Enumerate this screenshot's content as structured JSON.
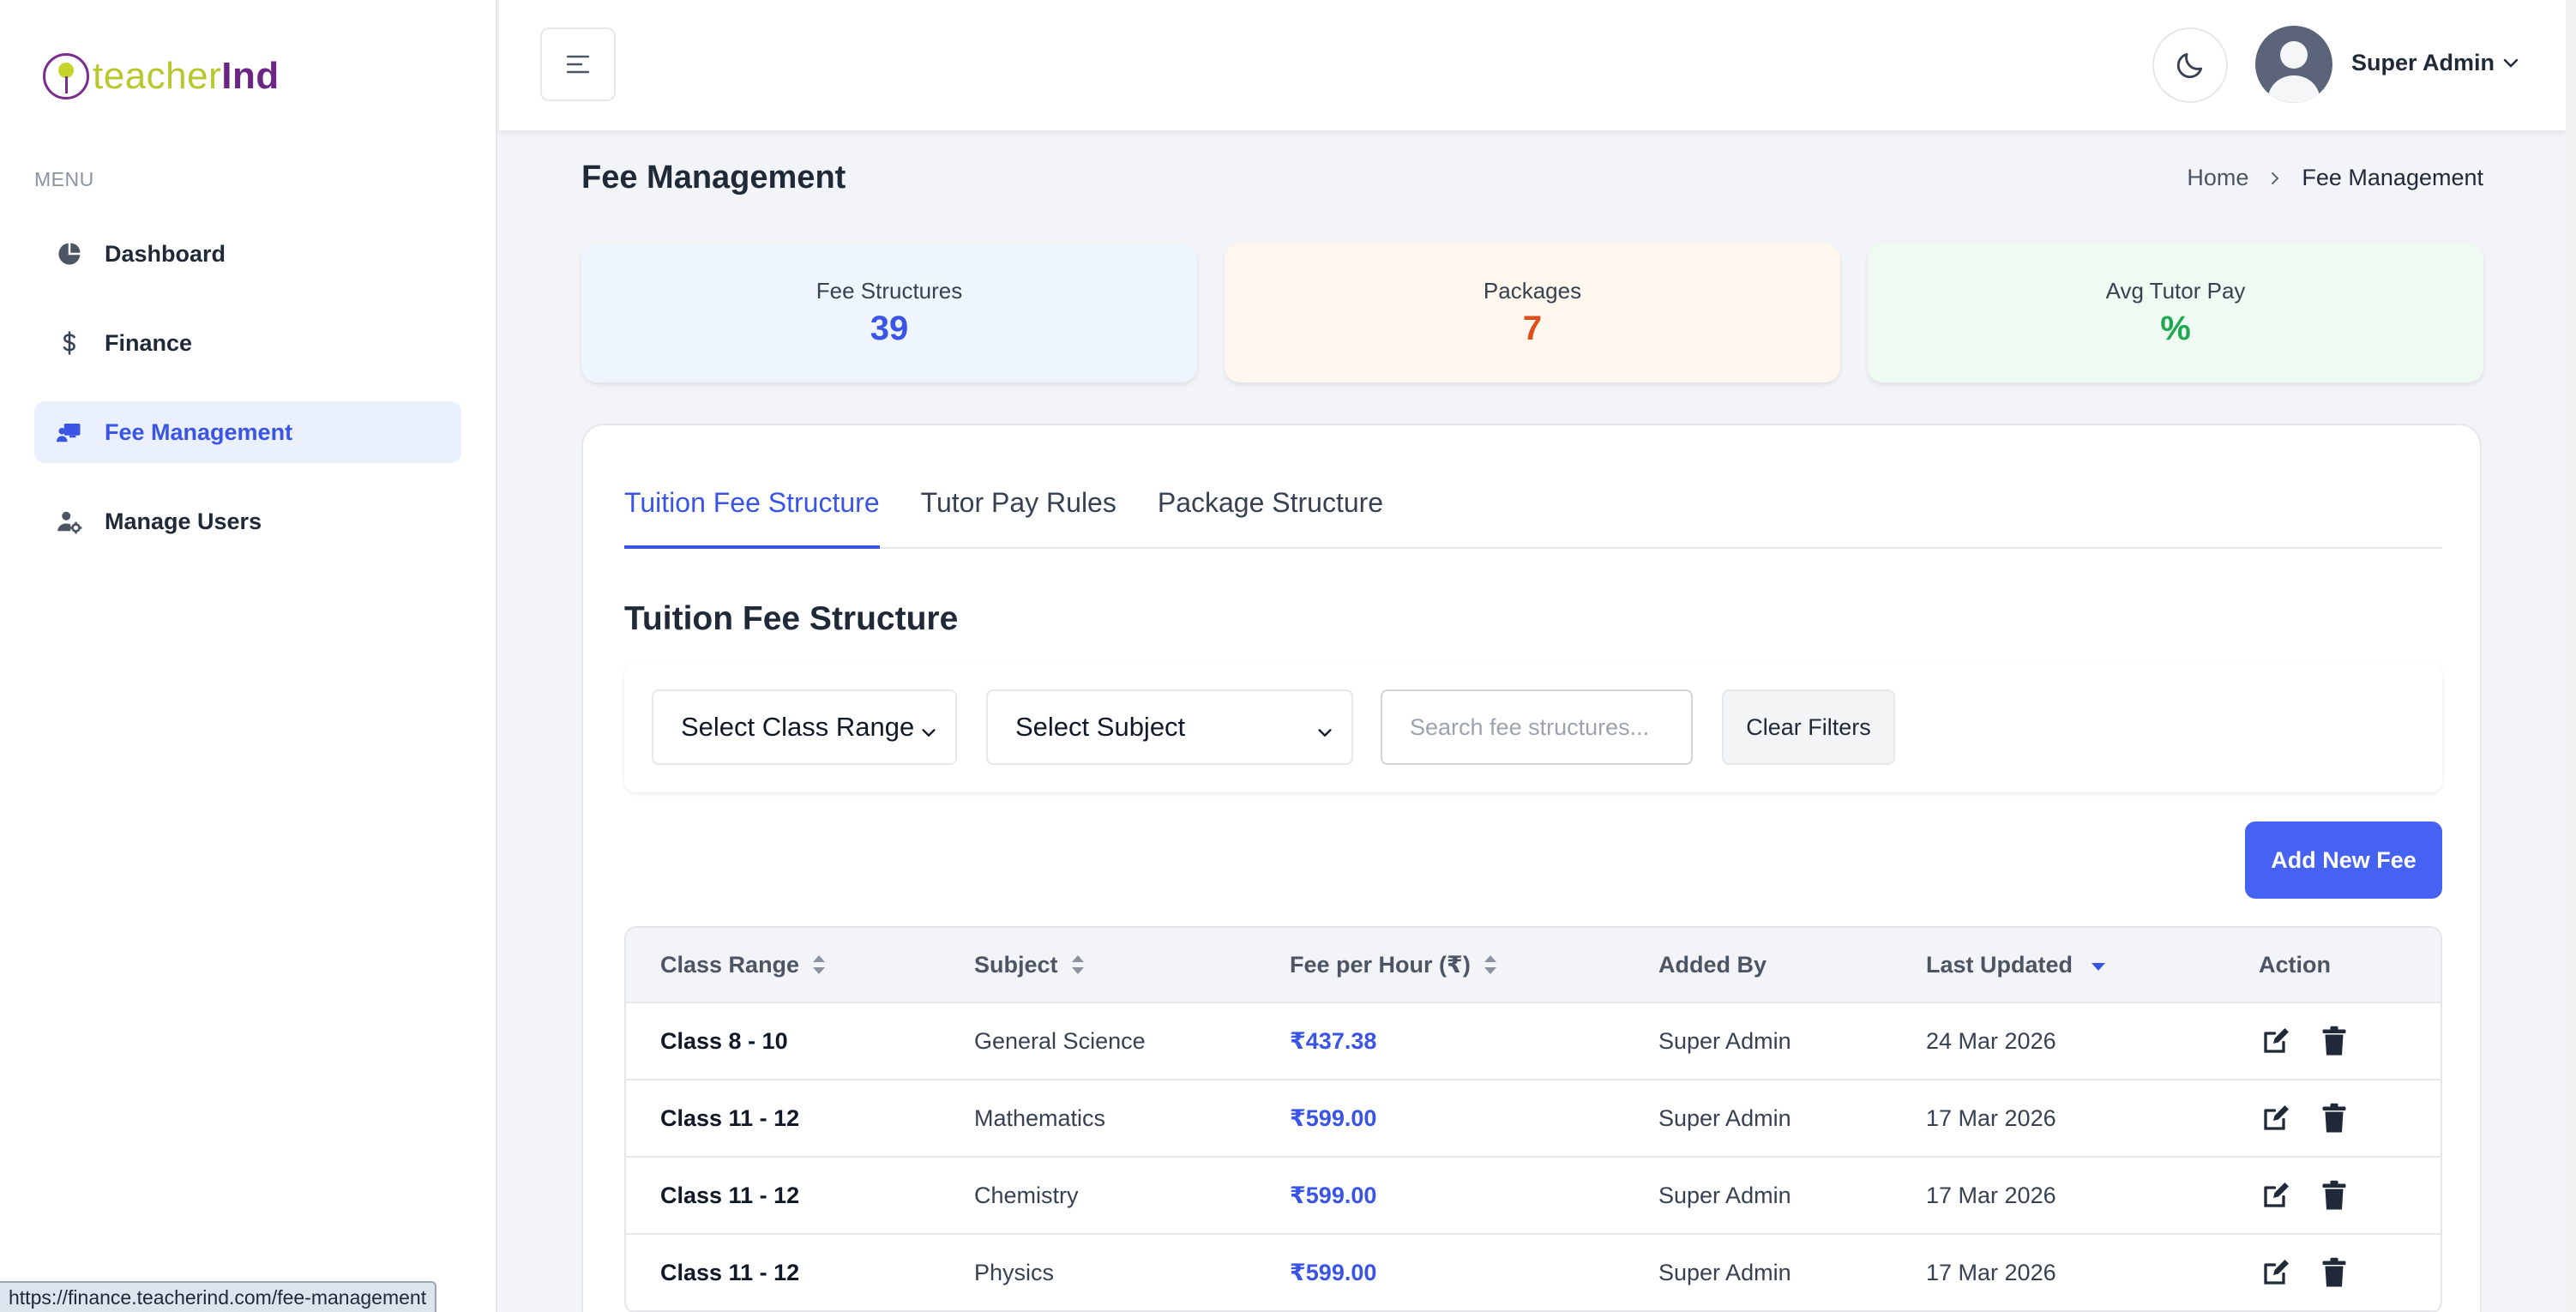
{
  "brand": {
    "logo_part1": "teacher",
    "logo_part2": "Ind"
  },
  "sidebar": {
    "menu_label": "MENU",
    "items": [
      {
        "label": "Dashboard",
        "icon": "pie-chart-icon"
      },
      {
        "label": "Finance",
        "icon": "dollar-icon"
      },
      {
        "label": "Fee Management",
        "icon": "teacher-board-icon",
        "active": true
      },
      {
        "label": "Manage Users",
        "icon": "user-gear-icon"
      }
    ]
  },
  "header": {
    "user_name": "Super Admin"
  },
  "page": {
    "title": "Fee Management",
    "breadcrumb": {
      "home": "Home",
      "current": "Fee Management"
    }
  },
  "stats": [
    {
      "label": "Fee Structures",
      "value": "39",
      "color": "#3a55e6",
      "bg": "#eef5fe"
    },
    {
      "label": "Packages",
      "value": "7",
      "color": "#e04e1c",
      "bg": "#fef7ee"
    },
    {
      "label": "Avg Tutor Pay",
      "value": "%",
      "color": "#1fa84f",
      "bg": "#effaf2"
    }
  ],
  "tabs": [
    "Tuition Fee Structure",
    "Tutor Pay Rules",
    "Package Structure"
  ],
  "section": {
    "title": "Tuition Fee Structure"
  },
  "filters": {
    "class_range": "Select Class Range",
    "subject": "Select Subject",
    "search_placeholder": "Search fee structures...",
    "clear_label": "Clear Filters"
  },
  "add_button": "Add New Fee",
  "table": {
    "columns": [
      "Class Range",
      "Subject",
      "Fee per Hour (₹)",
      "Added By",
      "Last Updated",
      "Action"
    ],
    "rows": [
      {
        "class_range": "Class 8 - 10",
        "subject": "General Science",
        "fee": "₹437.38",
        "added_by": "Super Admin",
        "updated": "24 Mar 2026"
      },
      {
        "class_range": "Class 11 - 12",
        "subject": "Mathematics",
        "fee": "₹599.00",
        "added_by": "Super Admin",
        "updated": "17 Mar 2026"
      },
      {
        "class_range": "Class 11 - 12",
        "subject": "Chemistry",
        "fee": "₹599.00",
        "added_by": "Super Admin",
        "updated": "17 Mar 2026"
      },
      {
        "class_range": "Class 11 - 12",
        "subject": "Physics",
        "fee": "₹599.00",
        "added_by": "Super Admin",
        "updated": "17 Mar 2026"
      }
    ]
  },
  "status_bar": {
    "url": "https://finance.teacherind.com/fee-management"
  }
}
